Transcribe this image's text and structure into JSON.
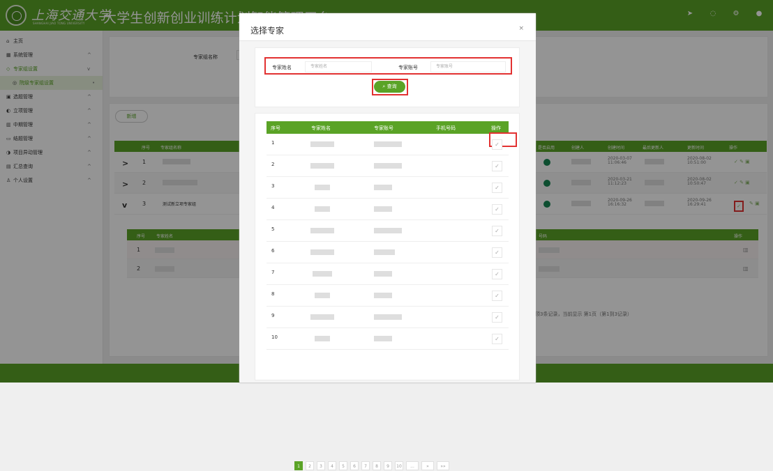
{
  "header": {
    "school_cn": "上海交通大学",
    "school_en": "SHANGHAI JIAO TONG UNIVERSITY",
    "platform_title": "大学生创新创业训练计划智能管理平台",
    "icons": [
      "send-icon",
      "bell-icon",
      "gear-icon",
      "user-icon"
    ]
  },
  "sidebar": {
    "items": [
      {
        "icon": "home-icon",
        "glyph": "⌂",
        "label": "主页",
        "arrow": ""
      },
      {
        "icon": "system-icon",
        "glyph": "▦",
        "label": "系统管理",
        "arrow": "^"
      },
      {
        "icon": "expert-group-icon",
        "glyph": "◇",
        "label": "专家组设置",
        "arrow": "v"
      },
      {
        "icon": "target-icon",
        "glyph": "◎",
        "label": "院级专家组设置",
        "arrow": "",
        "dot": "•"
      },
      {
        "icon": "topic-icon",
        "glyph": "▣",
        "label": "选题管理",
        "arrow": "^"
      },
      {
        "icon": "project-icon",
        "glyph": "◐",
        "label": "立项管理",
        "arrow": "^"
      },
      {
        "icon": "midterm-icon",
        "glyph": "▥",
        "label": "中期管理",
        "arrow": "^"
      },
      {
        "icon": "monitor-icon",
        "glyph": "▭",
        "label": "结题管理",
        "arrow": "^"
      },
      {
        "icon": "change-icon",
        "glyph": "◑",
        "label": "项目异动管理",
        "arrow": "^"
      },
      {
        "icon": "chart-icon",
        "glyph": "▤",
        "label": "汇总查询",
        "arrow": "^"
      },
      {
        "icon": "person-icon",
        "glyph": "♙",
        "label": "个人设置",
        "arrow": "^"
      }
    ]
  },
  "main": {
    "filter_label": "专家组名称",
    "add_button": "新增",
    "table_headers": [
      "序号",
      "专家组名称",
      "是否启用",
      "创建人",
      "创建时间",
      "最后更新人",
      "更新时间",
      "操作"
    ],
    "rows": [
      {
        "arrow": ">",
        "index": "1",
        "name": "",
        "created": "2020-03-07 11:06:46",
        "updated": "2020-08-02 10:51:00"
      },
      {
        "arrow": ">",
        "index": "2",
        "name": "",
        "created": "2020-03-21 11:12:23",
        "updated": "2020-08-02 10:50:47"
      },
      {
        "arrow": "v",
        "index": "3",
        "name": "测试新立项专家组",
        "created": "2020-09-26 16:16:32",
        "updated": "2020-09-26 16:29:41"
      }
    ],
    "sub_headers": [
      "序号",
      "专家姓名",
      "号码",
      "操作"
    ],
    "sub_rows": [
      "1",
      "2"
    ],
    "footer": "共顶3条记录，当前显示 第1页（第1到3记录）"
  },
  "modal": {
    "title": "选择专家",
    "close": "×",
    "search": {
      "name_label": "专家姓名",
      "name_placeholder": "专家姓名",
      "account_label": "专家账号",
      "account_placeholder": "专家账号",
      "query_label": "查询"
    },
    "table_headers": [
      "序号",
      "专家姓名",
      "专家账号",
      "手机号码",
      "操作"
    ],
    "rows": [
      "1",
      "2",
      "3",
      "4",
      "5",
      "6",
      "7",
      "8",
      "9",
      "10"
    ],
    "check_glyph": "✓",
    "pagination": [
      "1",
      "2",
      "3",
      "4",
      "5",
      "6",
      "7",
      "8",
      "9",
      "10",
      "...",
      "»",
      "»»"
    ]
  }
}
